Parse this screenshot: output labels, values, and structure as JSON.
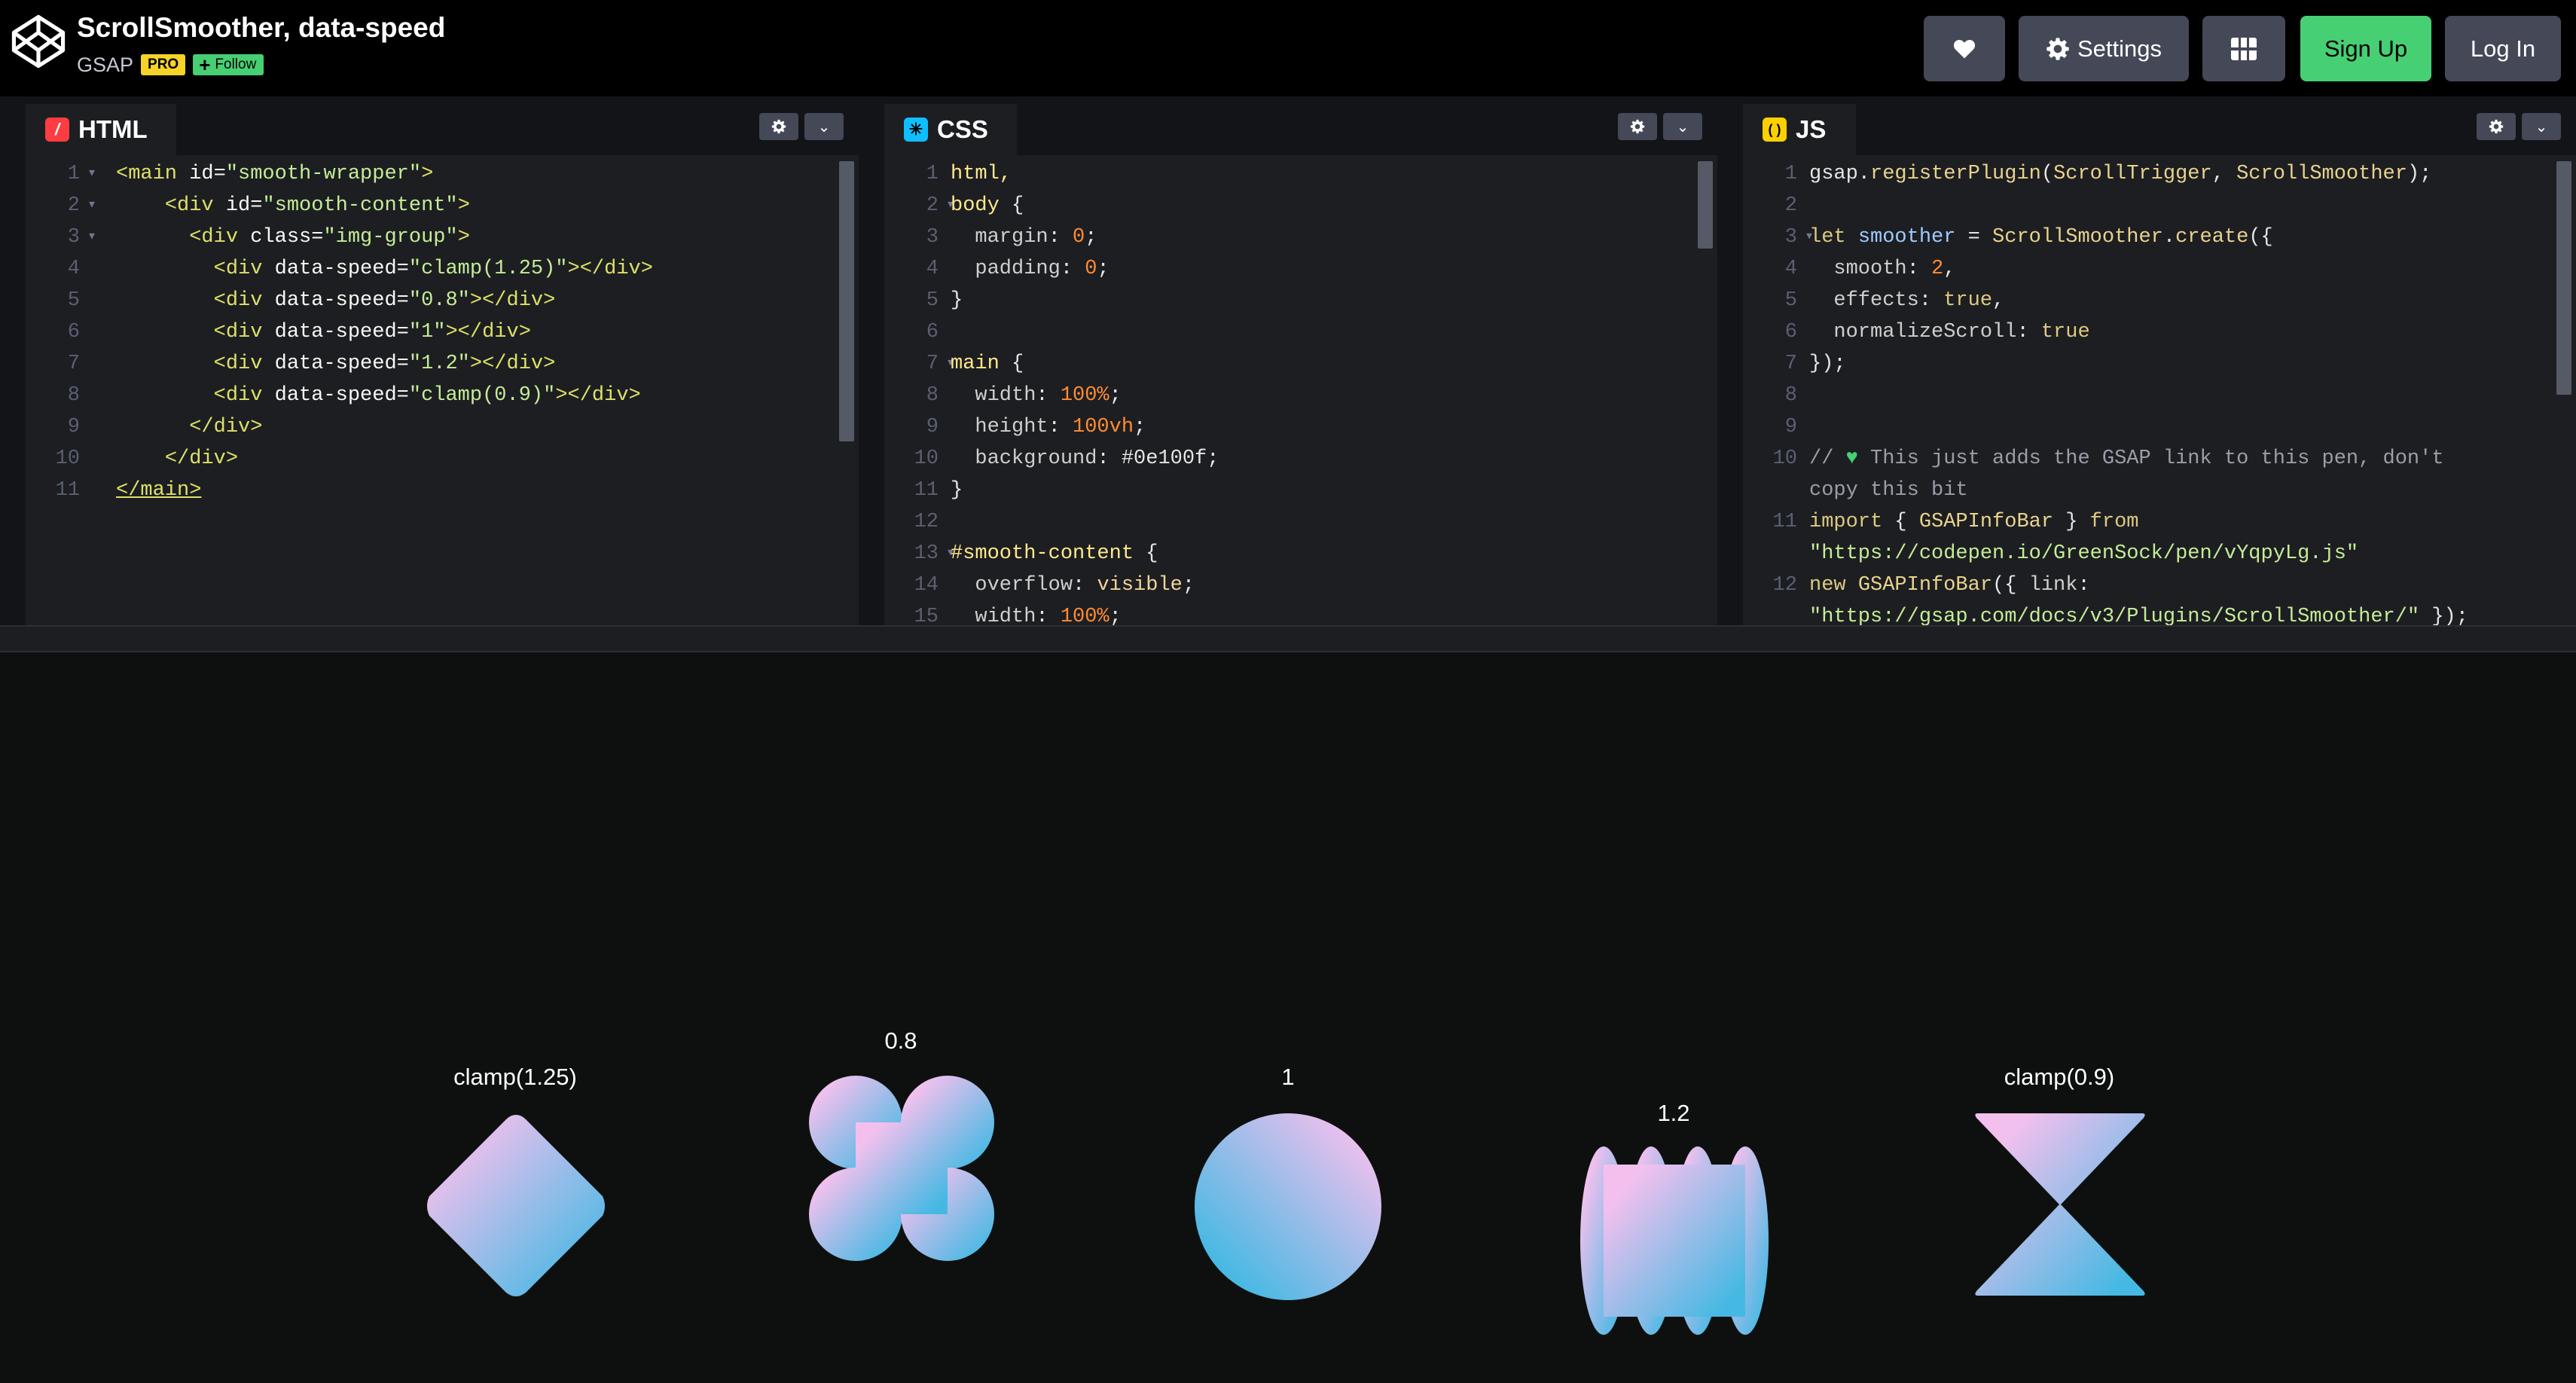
{
  "header": {
    "title": "ScrollSmoother, data-speed",
    "author": "GSAP",
    "pro_badge": "PRO",
    "follow_label": "Follow",
    "settings_label": "Settings",
    "signup_label": "Sign Up",
    "login_label": "Log In"
  },
  "editors": {
    "html": {
      "tab_label": "HTML",
      "line_count": 11
    },
    "css": {
      "tab_label": "CSS",
      "line_count": 15
    },
    "js": {
      "tab_label": "JS",
      "line_count": 12
    }
  },
  "preview": {
    "labels": [
      "clamp(1.25)",
      "0.8",
      "1",
      "1.2",
      "clamp(0.9)"
    ]
  },
  "colors": {
    "gradient_pink": "#f3c0ee",
    "gradient_blue": "#45b9e3",
    "accent_green": "#47cf73",
    "pro_yellow": "#f5d327"
  }
}
